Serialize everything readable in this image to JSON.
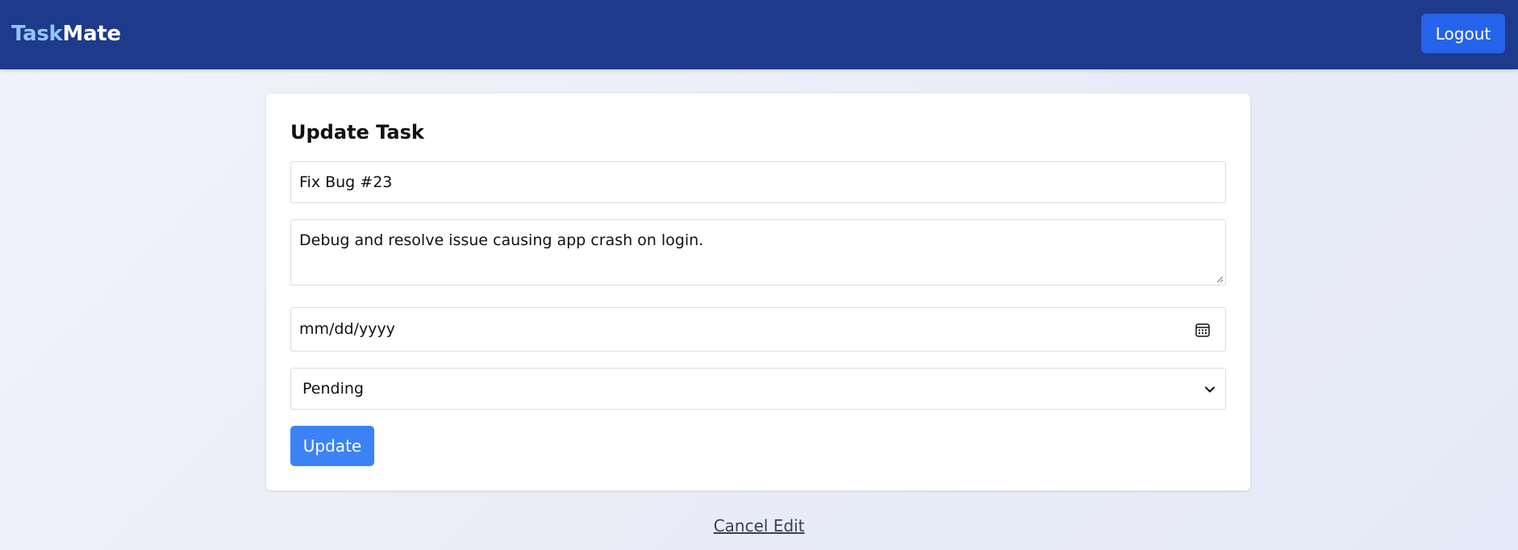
{
  "app": {
    "brand_part1": "Task",
    "brand_part2": "Mate",
    "accent_color": "#93c5fd",
    "navbar_color": "#1e3a8a"
  },
  "header": {
    "logout_label": "Logout",
    "logout_color": "#2563eb"
  },
  "form": {
    "heading": "Update Task",
    "title_value": "Fix Bug #23",
    "description_value": "Debug and resolve issue causing app crash on login.",
    "date_placeholder": "mm/dd/yyyy",
    "date_icon": "calendar-icon",
    "status_selected": "Pending",
    "status_icon": "chevron-down-icon",
    "submit_label": "Update",
    "submit_color": "#3b82f6"
  },
  "footer": {
    "cancel_label": "Cancel Edit"
  }
}
